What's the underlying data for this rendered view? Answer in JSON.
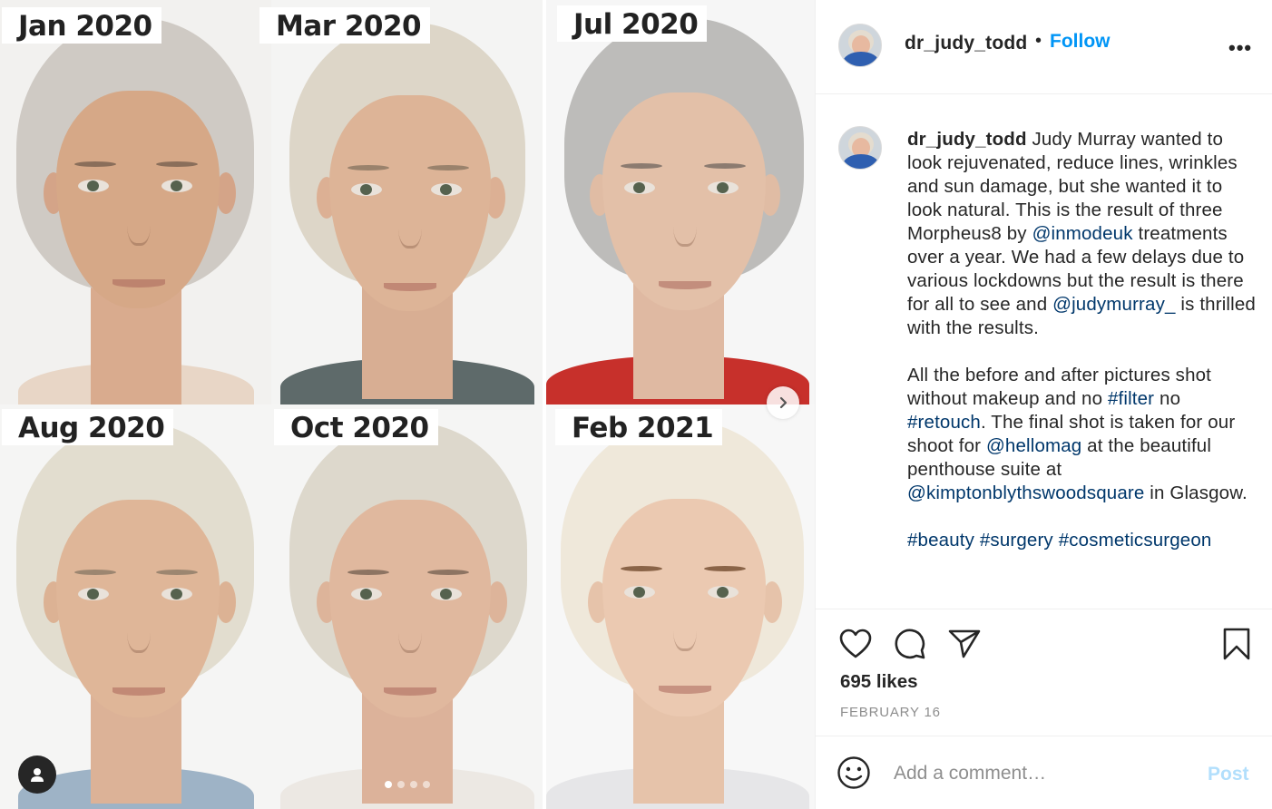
{
  "media": {
    "labels": [
      "Jan 2020",
      "Mar 2020",
      "Jul 2020",
      "Aug 2020",
      "Oct 2020",
      "Feb 2021"
    ],
    "carousel": {
      "total": 4,
      "active": 1
    }
  },
  "header": {
    "username": "dr_judy_todd",
    "separator": "•",
    "follow_label": "Follow",
    "more_label": "•••"
  },
  "caption": {
    "username": "dr_judy_todd",
    "p1": [
      {
        "text": " Judy Murray wanted to look rejuvenated, reduce lines, wrinkles and sun damage, but she wanted it to look natural.  This is the result of three Morpheus8 by ",
        "link": false
      },
      {
        "text": "@inmodeuk",
        "link": true
      },
      {
        "text": " treatments over a year. We had a few delays due to various lockdowns but the result is there for all to see and ",
        "link": false
      },
      {
        "text": "@judymurray_",
        "link": true
      },
      {
        "text": " is thrilled with the results.",
        "link": false
      }
    ],
    "p2": [
      {
        "text": "All the before and after pictures shot without makeup and no ",
        "link": false
      },
      {
        "text": "#filter",
        "link": true
      },
      {
        "text": " no ",
        "link": false
      },
      {
        "text": "#retouch",
        "link": true
      },
      {
        "text": ". The final shot is taken for our shoot for ",
        "link": false
      },
      {
        "text": "@hellomag",
        "link": true
      },
      {
        "text": " at the beautiful penthouse suite at ",
        "link": false
      },
      {
        "text": "@kimptonblythswoodsquare",
        "link": true
      },
      {
        "text": " in Glasgow.",
        "link": false
      }
    ],
    "p3": [
      {
        "text": "#beauty",
        "link": true
      },
      {
        "text": " ",
        "link": false
      },
      {
        "text": "#surgery",
        "link": true
      },
      {
        "text": " ",
        "link": false
      },
      {
        "text": "#cosmeticsurgeon",
        "link": true
      }
    ]
  },
  "stats": {
    "likes": "695 likes",
    "date": "FEBRUARY 16"
  },
  "comment": {
    "placeholder": "Add a comment…",
    "post_label": "Post"
  },
  "colors": {
    "link": "#00376b",
    "follow": "#0095f6",
    "post_disabled": "#b2dffc"
  }
}
